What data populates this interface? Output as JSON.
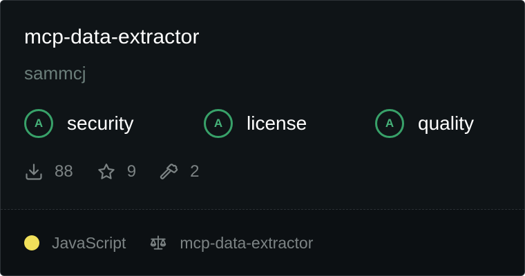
{
  "card": {
    "title": "mcp-data-extractor",
    "owner": "sammcj"
  },
  "badges": [
    {
      "grade": "A",
      "label": "security",
      "icon": "grade-circle"
    },
    {
      "grade": "A",
      "label": "license",
      "icon": "grade-circle"
    },
    {
      "grade": "A",
      "label": "quality",
      "icon": "grade-circle"
    }
  ],
  "stats": {
    "downloads": {
      "icon": "download-icon",
      "value": "88"
    },
    "stars": {
      "icon": "star-icon",
      "value": "9"
    },
    "tools": {
      "icon": "hammer-icon",
      "value": "2"
    }
  },
  "footer": {
    "language": "JavaScript",
    "language_color": "#f1e05a",
    "license_icon": "scale-icon",
    "repo": "mcp-data-extractor"
  },
  "colors": {
    "background": "#0f1417",
    "grade_accent": "#38a169",
    "muted_text": "#7c8384"
  }
}
